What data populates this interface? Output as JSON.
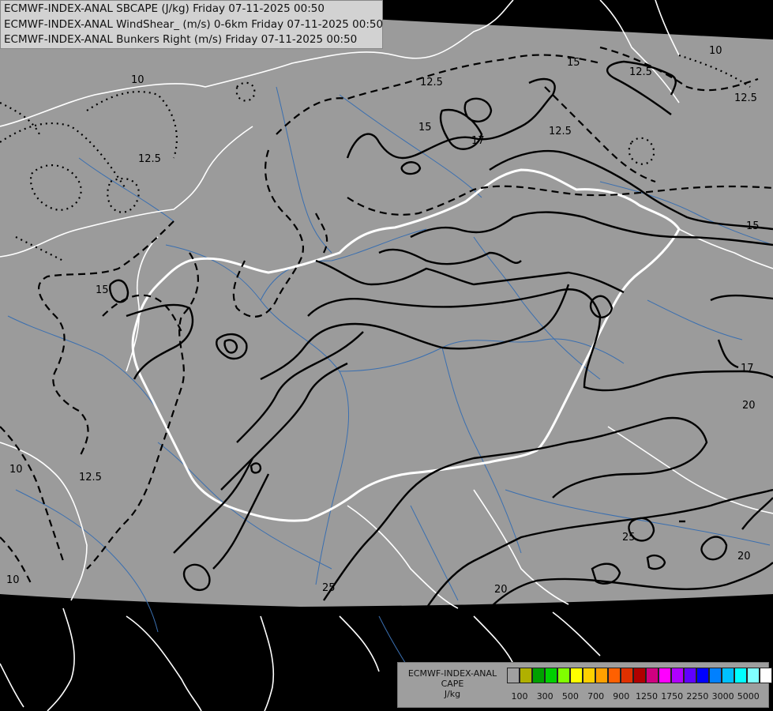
{
  "header": {
    "line1": "ECMWF-INDEX-ANAL SBCAPE (J/kg) Friday 07-11-2025 00:50",
    "line2": "ECMWF-INDEX-ANAL WindShear_ (m/s) 0-6km Friday 07-11-2025 00:50",
    "line3": "ECMWF-INDEX-ANAL Bunkers Right (m/s) Friday 07-11-2025 00:50"
  },
  "legend": {
    "line1": "ECMWF-INDEX-ANAL",
    "line2": "CAPE",
    "line3": "J/kg",
    "colors": [
      "#a0a0a0",
      "#b0b000",
      "#00a000",
      "#00d000",
      "#80ff00",
      "#ffff00",
      "#ffd000",
      "#ffa000",
      "#ff6000",
      "#e03000",
      "#b00000",
      "#d00080",
      "#ff00ff",
      "#b000ff",
      "#6000ff",
      "#0000ff",
      "#0080ff",
      "#00c0ff",
      "#00ffff",
      "#80ffff",
      "#ffffff"
    ],
    "ticks": [
      "100",
      "300",
      "500",
      "700",
      "900",
      "1250",
      "1750",
      "2250",
      "3000",
      "5000"
    ]
  },
  "contour_labels": {
    "l15a": "15",
    "l12_5a": "12.5",
    "l10a": "10",
    "l12_5b": "12.5",
    "l15b": "15",
    "l12_5c": "12.5",
    "l12_5d": "12.5",
    "l17a": "17",
    "l15c": "15",
    "l10b": "10",
    "l12_5e": "12.5",
    "l15d": "15",
    "l17b": "17",
    "l20a": "20",
    "l10c": "10",
    "l12_5f": "12.5",
    "l10d": "10",
    "l25a": "25",
    "l25b": "25",
    "l20b": "20",
    "l20c": "20"
  },
  "colors": {
    "domain_fill": "#9b9b9b",
    "outside": "#000000",
    "borders": "#ffffff",
    "rivers": "#3a6fb0",
    "contour": "#000000"
  }
}
